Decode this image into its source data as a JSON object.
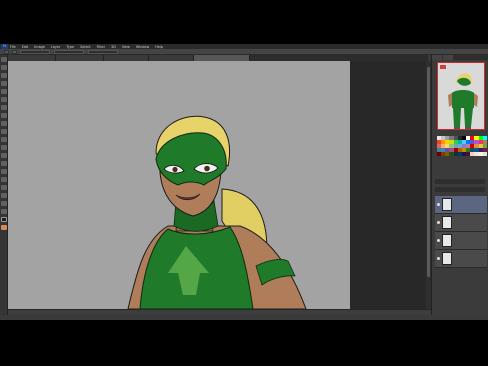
{
  "app": {
    "logo": "Ps",
    "menus": [
      "File",
      "Edit",
      "Image",
      "Layer",
      "Type",
      "Select",
      "Filter",
      "3D",
      "View",
      "Window",
      "Help"
    ]
  },
  "document_tabs": [
    {
      "label": "",
      "active": false
    },
    {
      "label": "",
      "active": false
    },
    {
      "label": "",
      "active": false
    },
    {
      "label": "",
      "active": false
    },
    {
      "label": "",
      "active": true
    }
  ],
  "panels": {
    "top_tabs": [
      "",
      ""
    ],
    "swatch_colors": [
      "#e8e8e8",
      "#c8c8c8",
      "#a0a0a0",
      "#787878",
      "#505050",
      "#282828",
      "#000000",
      "#ffffff",
      "#ff0000",
      "#ffff00",
      "#00ff00",
      "#00ffff",
      "#ff3b30",
      "#ff9500",
      "#ffcc00",
      "#c3e600",
      "#34c759",
      "#00b8a9",
      "#5ac8fa",
      "#007aff",
      "#5856d6",
      "#af52de",
      "#ff2d55",
      "#a2845e",
      "#e06666",
      "#f6b26b",
      "#ffd966",
      "#93c47d",
      "#76a5af",
      "#6fa8dc",
      "#8e7cc3",
      "#c27ba0",
      "#cc0000",
      "#e69138",
      "#f1c232",
      "#6aa84f",
      "#45818e",
      "#3d85c6",
      "#674ea7",
      "#a64d79",
      "#990000",
      "#b45f06",
      "#bf9000",
      "#38761d",
      "#134f5c",
      "#0b5394",
      "#351c75",
      "#741b47",
      "#660000",
      "#783f04",
      "#7f6000",
      "#274e13",
      "#0c343d",
      "#073763",
      "#20124d",
      "#4c1130",
      "#f4cccc",
      "#fce5cd",
      "#fff2cc",
      "#d9ead3"
    ],
    "layers": [
      {
        "name": "",
        "selected": true
      },
      {
        "name": "",
        "selected": false
      },
      {
        "name": "",
        "selected": false
      },
      {
        "name": "",
        "selected": false
      }
    ]
  },
  "canvas": {
    "background": "#a3a3a3",
    "suit_green": "#1f7a2a",
    "hair_yellow": "#e8d36a",
    "skin": "#b07d5a"
  }
}
